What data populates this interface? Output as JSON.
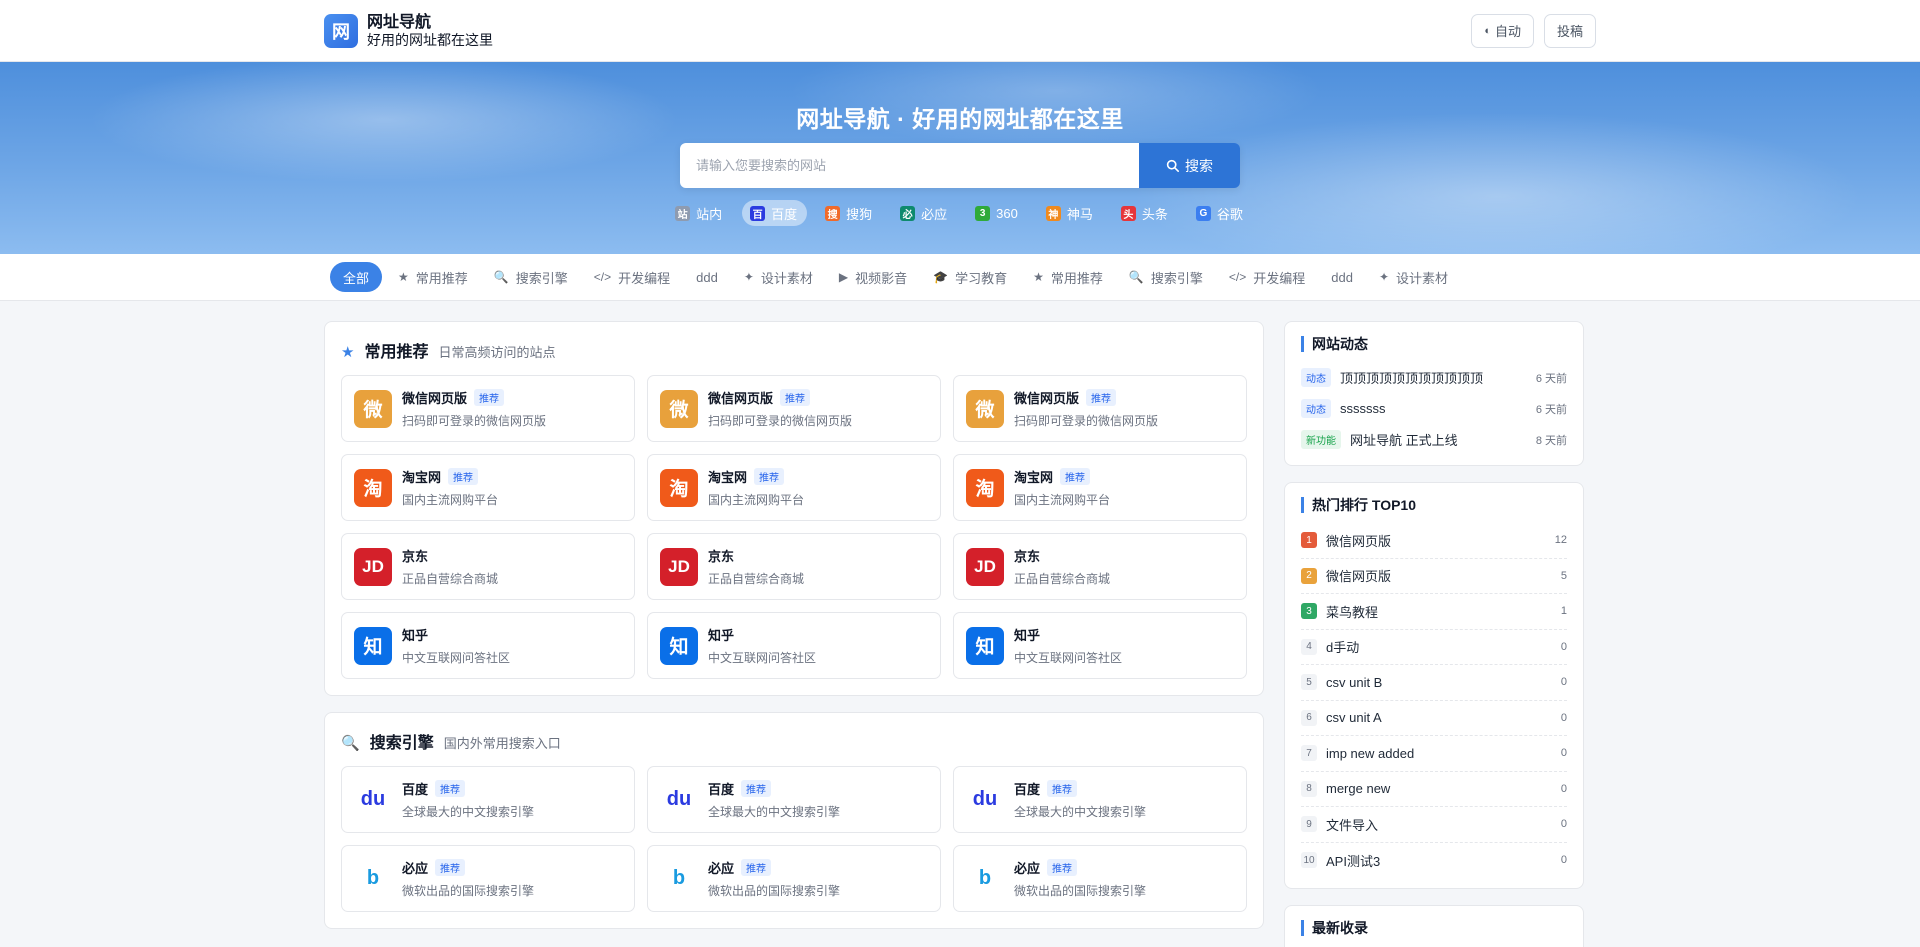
{
  "header": {
    "logo_char": "网",
    "title": "网址导航",
    "subtitle": "好用的网址都在这里",
    "theme_label": "自动",
    "theme_icon": "◐",
    "submit_label": "投稿"
  },
  "hero": {
    "title": "网址导航 · 好用的网址都在这里",
    "search_placeholder": "请输入您要搜索的网站",
    "search_button": "搜索",
    "engines": [
      {
        "icon": "站",
        "label": "站内",
        "color": "#8e9bb0"
      },
      {
        "icon": "百",
        "label": "百度",
        "color": "#2b3be0",
        "active": true
      },
      {
        "icon": "搜",
        "label": "搜狗",
        "color": "#f06a2a"
      },
      {
        "icon": "必",
        "label": "必应",
        "color": "#0e8a6e"
      },
      {
        "icon": "3",
        "label": "360",
        "color": "#2faa3a"
      },
      {
        "icon": "神",
        "label": "神马",
        "color": "#f08a1e"
      },
      {
        "icon": "头",
        "label": "头条",
        "color": "#e6353a"
      },
      {
        "icon": "G",
        "label": "谷歌",
        "color": "#3b7ef0"
      }
    ]
  },
  "categories": [
    {
      "label": "全部",
      "icon": "",
      "active": true
    },
    {
      "label": "常用推荐",
      "icon": "★"
    },
    {
      "label": "搜索引擎",
      "icon": "🔍"
    },
    {
      "label": "开发编程",
      "icon": "</>"
    },
    {
      "label": "ddd",
      "icon": ""
    },
    {
      "label": "设计素材",
      "icon": "✦"
    },
    {
      "label": "视频影音",
      "icon": "▶"
    },
    {
      "label": "学习教育",
      "icon": "🎓"
    },
    {
      "label": "常用推荐",
      "icon": "★"
    },
    {
      "label": "搜索引擎",
      "icon": "🔍"
    },
    {
      "label": "开发编程",
      "icon": "</>"
    },
    {
      "label": "ddd",
      "icon": ""
    },
    {
      "label": "设计素材",
      "icon": "✦"
    }
  ],
  "sections": [
    {
      "icon": "★",
      "title": "常用推荐",
      "subtitle": "日常高频访问的站点",
      "cards": [
        {
          "name": "微信网页版",
          "badge": "推荐",
          "desc": "扫码即可登录的微信网页版",
          "icon_char": "微",
          "icon_color": "#e8a13c"
        },
        {
          "name": "微信网页版",
          "badge": "推荐",
          "desc": "扫码即可登录的微信网页版",
          "icon_char": "微",
          "icon_color": "#e8a13c"
        },
        {
          "name": "微信网页版",
          "badge": "推荐",
          "desc": "扫码即可登录的微信网页版",
          "icon_char": "微",
          "icon_color": "#e8a13c"
        },
        {
          "name": "淘宝网",
          "badge": "推荐",
          "desc": "国内主流网购平台",
          "icon_char": "淘",
          "icon_color": "#f05a1a"
        },
        {
          "name": "淘宝网",
          "badge": "推荐",
          "desc": "国内主流网购平台",
          "icon_char": "淘",
          "icon_color": "#f05a1a"
        },
        {
          "name": "淘宝网",
          "badge": "推荐",
          "desc": "国内主流网购平台",
          "icon_char": "淘",
          "icon_color": "#f05a1a"
        },
        {
          "name": "京东",
          "badge": "",
          "desc": "正品自营综合商城",
          "icon_char": "JD",
          "icon_color": "#d4202a"
        },
        {
          "name": "京东",
          "badge": "",
          "desc": "正品自营综合商城",
          "icon_char": "JD",
          "icon_color": "#d4202a"
        },
        {
          "name": "京东",
          "badge": "",
          "desc": "正品自营综合商城",
          "icon_char": "JD",
          "icon_color": "#d4202a"
        },
        {
          "name": "知乎",
          "badge": "",
          "desc": "中文互联网问答社区",
          "icon_char": "知",
          "icon_color": "#0a6fe8"
        },
        {
          "name": "知乎",
          "badge": "",
          "desc": "中文互联网问答社区",
          "icon_char": "知",
          "icon_color": "#0a6fe8"
        },
        {
          "name": "知乎",
          "badge": "",
          "desc": "中文互联网问答社区",
          "icon_char": "知",
          "icon_color": "#0a6fe8"
        }
      ]
    },
    {
      "icon": "🔍",
      "title": "搜索引擎",
      "subtitle": "国内外常用搜索入口",
      "cards": [
        {
          "name": "百度",
          "badge": "推荐",
          "desc": "全球最大的中文搜索引擎",
          "icon_char": "du",
          "icon_color": "#2b3be0",
          "icon_style": "text"
        },
        {
          "name": "百度",
          "badge": "推荐",
          "desc": "全球最大的中文搜索引擎",
          "icon_char": "du",
          "icon_color": "#2b3be0",
          "icon_style": "text"
        },
        {
          "name": "百度",
          "badge": "推荐",
          "desc": "全球最大的中文搜索引擎",
          "icon_char": "du",
          "icon_color": "#2b3be0",
          "icon_style": "text"
        },
        {
          "name": "必应",
          "badge": "推荐",
          "desc": "微软出品的国际搜索引擎",
          "icon_char": "b",
          "icon_color": "#1a9be0",
          "icon_style": "text"
        },
        {
          "name": "必应",
          "badge": "推荐",
          "desc": "微软出品的国际搜索引擎",
          "icon_char": "b",
          "icon_color": "#1a9be0",
          "icon_style": "text"
        },
        {
          "name": "必应",
          "badge": "推荐",
          "desc": "微软出品的国际搜索引擎",
          "icon_char": "b",
          "icon_color": "#1a9be0",
          "icon_style": "text"
        }
      ]
    }
  ],
  "sidebar": {
    "news_title": "网站动态",
    "news": [
      {
        "tag": "动态",
        "tag_type": "dyn",
        "text": "顶顶顶顶顶顶顶顶顶顶顶",
        "time": "6 天前"
      },
      {
        "tag": "动态",
        "tag_type": "dyn",
        "text": "sssssss",
        "time": "6 天前"
      },
      {
        "tag": "新功能",
        "tag_type": "new",
        "text": "网址导航 正式上线",
        "time": "8 天前"
      }
    ],
    "rank_title": "热门排行 TOP10",
    "ranks": [
      {
        "n": "1",
        "name": "微信网页版",
        "count": "12"
      },
      {
        "n": "2",
        "name": "微信网页版",
        "count": "5"
      },
      {
        "n": "3",
        "name": "菜鸟教程",
        "count": "1"
      },
      {
        "n": "4",
        "name": "d手动",
        "count": "0"
      },
      {
        "n": "5",
        "name": "csv unit B",
        "count": "0"
      },
      {
        "n": "6",
        "name": "csv unit A",
        "count": "0"
      },
      {
        "n": "7",
        "name": "imp new added",
        "count": "0"
      },
      {
        "n": "8",
        "name": "merge new",
        "count": "0"
      },
      {
        "n": "9",
        "name": "文件导入",
        "count": "0"
      },
      {
        "n": "10",
        "name": "API测试3",
        "count": "0"
      }
    ],
    "latest_title": "最新收录"
  }
}
